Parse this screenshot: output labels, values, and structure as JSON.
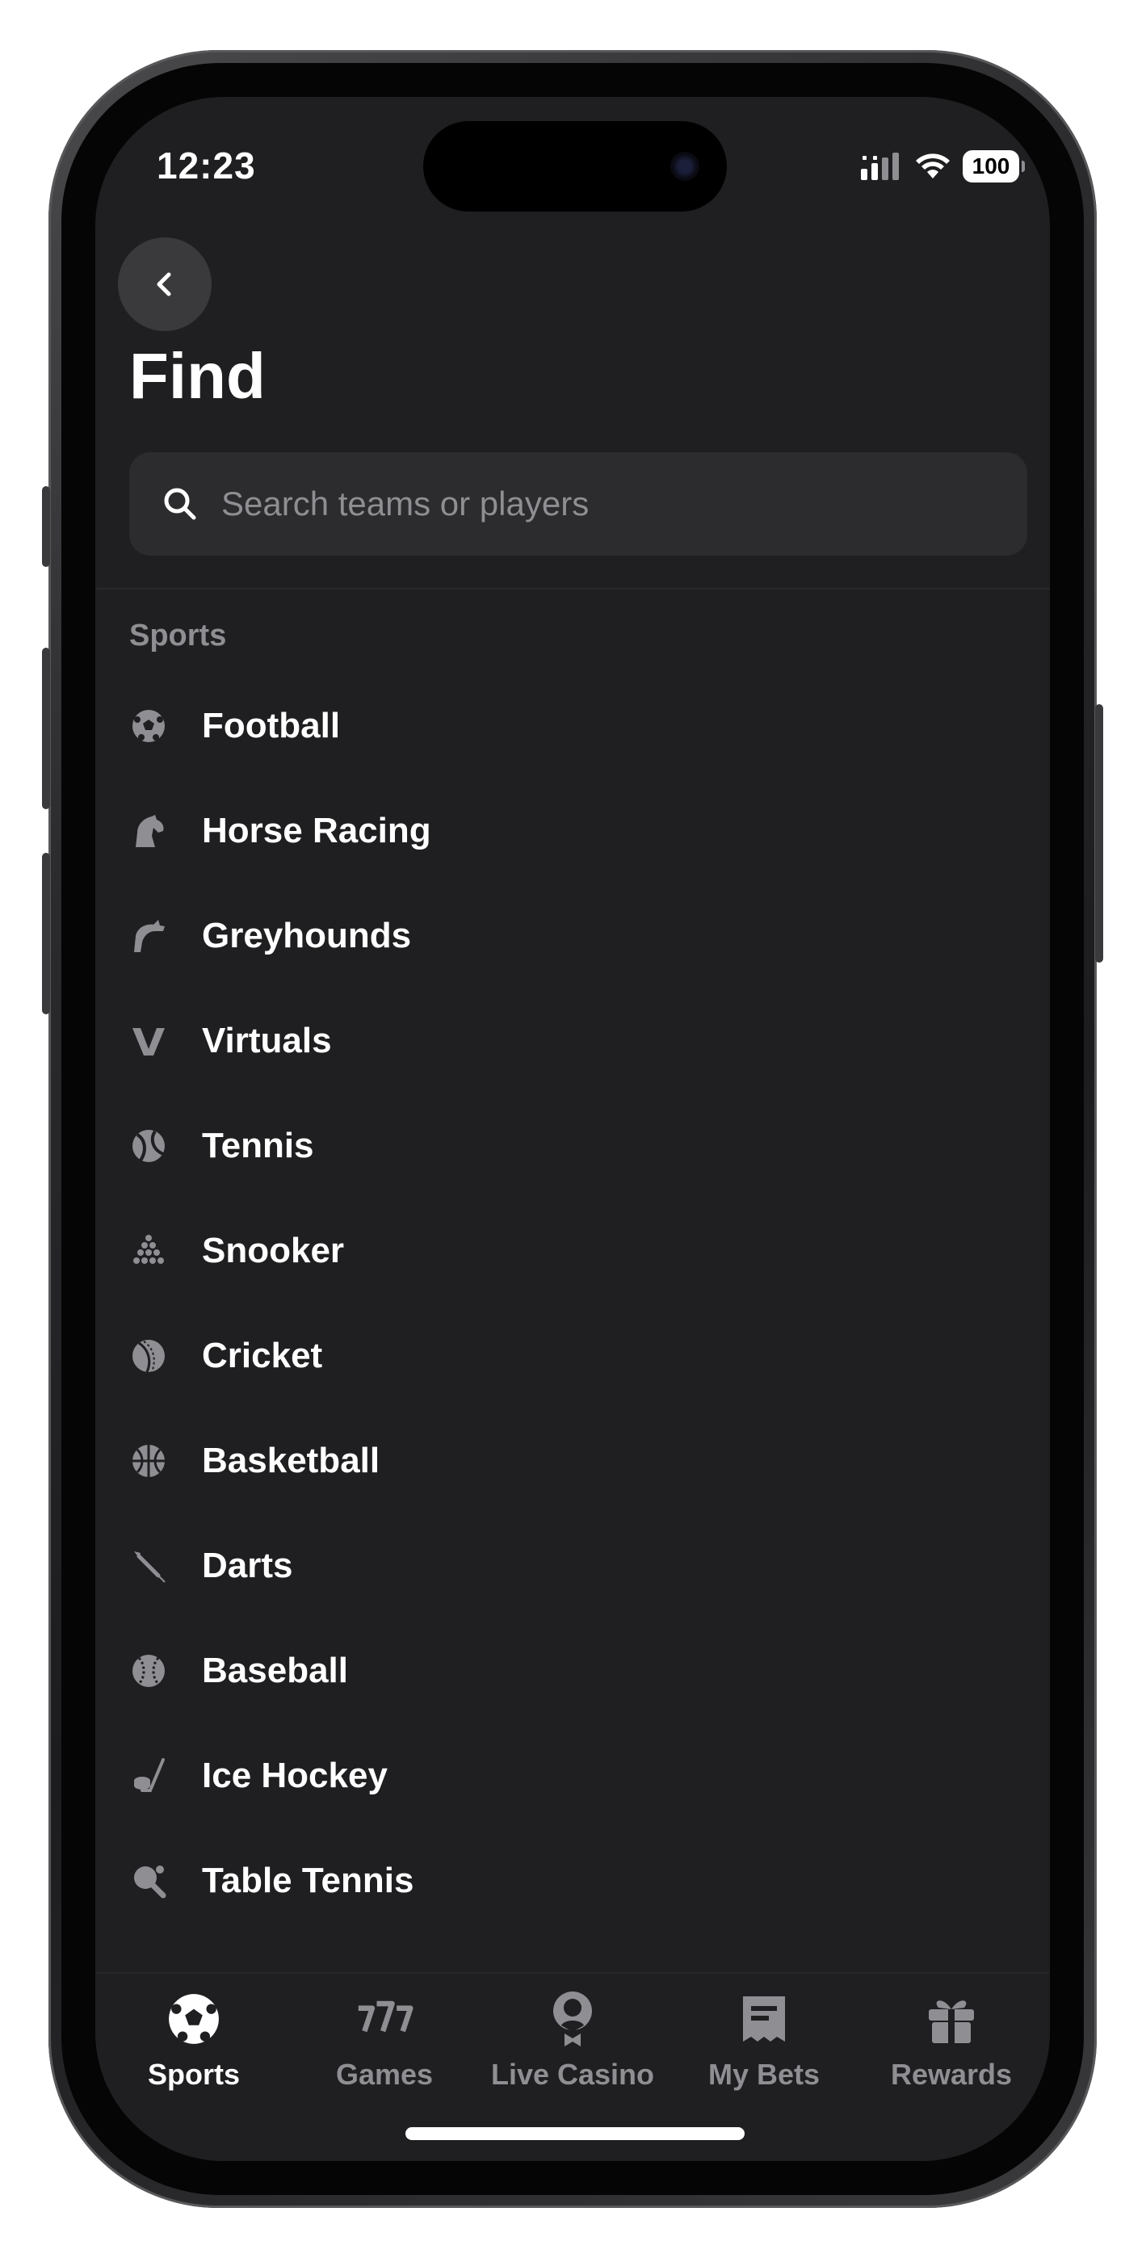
{
  "status_bar": {
    "time": "12:23",
    "battery": "100"
  },
  "header": {
    "title": "Find",
    "back_icon": "chevron-left-icon"
  },
  "search": {
    "placeholder": "Search teams or players",
    "value": ""
  },
  "section": {
    "label": "Sports"
  },
  "sports": [
    {
      "label": "Football",
      "icon": "football-icon"
    },
    {
      "label": "Horse Racing",
      "icon": "horse-icon"
    },
    {
      "label": "Greyhounds",
      "icon": "greyhound-icon"
    },
    {
      "label": "Virtuals",
      "icon": "virtuals-icon"
    },
    {
      "label": "Tennis",
      "icon": "tennis-ball-icon"
    },
    {
      "label": "Snooker",
      "icon": "snooker-balls-icon"
    },
    {
      "label": "Cricket",
      "icon": "cricket-ball-icon"
    },
    {
      "label": "Basketball",
      "icon": "basketball-icon"
    },
    {
      "label": "Darts",
      "icon": "dart-icon"
    },
    {
      "label": "Baseball",
      "icon": "baseball-icon"
    },
    {
      "label": "Ice Hockey",
      "icon": "ice-hockey-icon"
    },
    {
      "label": "Table Tennis",
      "icon": "table-tennis-icon"
    }
  ],
  "tabbar": {
    "active": "Sports",
    "tabs": [
      {
        "label": "Sports",
        "icon": "football-icon"
      },
      {
        "label": "Games",
        "icon": "slots-777-icon"
      },
      {
        "label": "Live Casino",
        "icon": "dealer-icon"
      },
      {
        "label": "My Bets",
        "icon": "bet-slip-icon"
      },
      {
        "label": "Rewards",
        "icon": "gift-icon"
      }
    ]
  },
  "colors": {
    "background": "#1f1f21",
    "search_bg": "#2c2c2e",
    "muted_text": "#8e8e93",
    "icon_gray": "#8e8e93",
    "text": "#ffffff"
  }
}
